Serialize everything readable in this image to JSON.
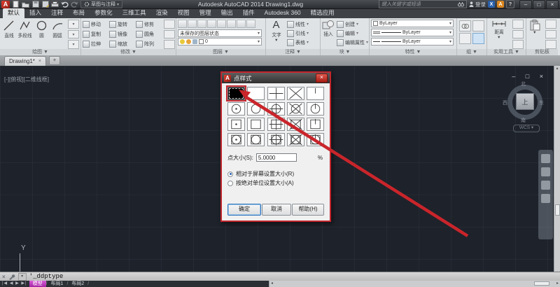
{
  "titlebar": {
    "logo": "A",
    "workspace": "草图与注释",
    "title": "Autodesk AutoCAD 2014   Drawing1.dwg",
    "search_placeholder": "键入关键字或短语",
    "signin": "登录",
    "exchange_badge": "X",
    "apps_badge": "A",
    "help_badge": "?"
  },
  "icons": {
    "dropdown": "▾",
    "expand_down": "▼",
    "minimize": "–",
    "maximize": "□",
    "close": "×",
    "plus": "+",
    "nav": "|◀ ◀ ▶ ▶|",
    "scroll_left": "◂",
    "scroll_right": "▸",
    "scroll_up": "▴",
    "slash": "/"
  },
  "ribbon": {
    "tabs": [
      "默认",
      "插入",
      "注释",
      "布局",
      "参数化",
      "三维工具",
      "渲染",
      "视图",
      "管理",
      "输出",
      "插件",
      "Autodesk 360",
      "精选应用"
    ],
    "active_tab": "默认",
    "panels": {
      "draw": {
        "label": "绘图 ▼",
        "tools": [
          "直线",
          "多段线",
          "圆",
          "圆弧"
        ]
      },
      "modify": {
        "label": "修改 ▼",
        "tools": [
          "移动",
          "旋转",
          "修剪",
          "复制",
          "镜像",
          "圆角",
          "拉伸",
          "缩放",
          "阵列"
        ]
      },
      "layers": {
        "label": "图层 ▼",
        "state_dropdown": "未保存的图层状态",
        "layer_dropdown": "0"
      },
      "annotate": {
        "label": "注释 ▼",
        "big_tool": "文字",
        "big_glyph": "A",
        "tools": [
          "线性",
          "引线",
          "表格"
        ]
      },
      "block": {
        "label": "块 ▼",
        "big_tool": "插入",
        "tools": [
          "创建",
          "编辑",
          "编辑属性"
        ]
      },
      "properties": {
        "label": "特性 ▼",
        "rows": [
          "ByLayer",
          "ByLayer",
          "ByLayer"
        ]
      },
      "group": {
        "label": "组 ▼"
      },
      "utilities": {
        "label": "实用工具 ▼",
        "big_tool": "距离"
      },
      "clipboard": {
        "label": "剪贴板"
      }
    }
  },
  "file_tabs": {
    "active": "Drawing1*"
  },
  "canvas": {
    "viewport_label": "[-][俯视][二维线框]",
    "ucs_axis": "Y",
    "viewcube": {
      "north": "北",
      "south": "南",
      "east": "东",
      "west": "西",
      "top": "上",
      "wcs": "WCS ▾"
    }
  },
  "dialog": {
    "title": "点样式",
    "point_styles": [
      {
        "type": "dot",
        "selected": true
      },
      {
        "type": "blank"
      },
      {
        "type": "plus"
      },
      {
        "type": "cross"
      },
      {
        "type": "tick"
      },
      {
        "type": "circle-dot"
      },
      {
        "type": "circle"
      },
      {
        "type": "circle-plus"
      },
      {
        "type": "circle-cross"
      },
      {
        "type": "circle-tick"
      },
      {
        "type": "square-dot"
      },
      {
        "type": "square"
      },
      {
        "type": "square-plus"
      },
      {
        "type": "square-cross"
      },
      {
        "type": "square-tick"
      },
      {
        "type": "square-circle-dot"
      },
      {
        "type": "square-circle"
      },
      {
        "type": "square-circle-plus"
      },
      {
        "type": "square-circle-cross"
      },
      {
        "type": "square-circle-tick"
      }
    ],
    "point_size_label": "点大小(S):",
    "point_size_value": "5.0000",
    "percent": "%",
    "radios": [
      {
        "label": "相对于屏幕设置大小(R)",
        "selected": true
      },
      {
        "label": "按绝对单位设置大小(A)",
        "selected": false
      }
    ],
    "buttons": [
      "确定",
      "取消",
      "帮助(H)"
    ]
  },
  "command_line": {
    "text": "'_ddptype"
  },
  "bottom": {
    "tabs": [
      "模型",
      "布局1",
      "布局2"
    ],
    "active": "模型"
  },
  "colors": {
    "annotation_red": "#c2262e",
    "model_tab_magenta": "#c438c4",
    "canvas_bg": "#1e222a",
    "bylayer_white": "#ffffff"
  }
}
